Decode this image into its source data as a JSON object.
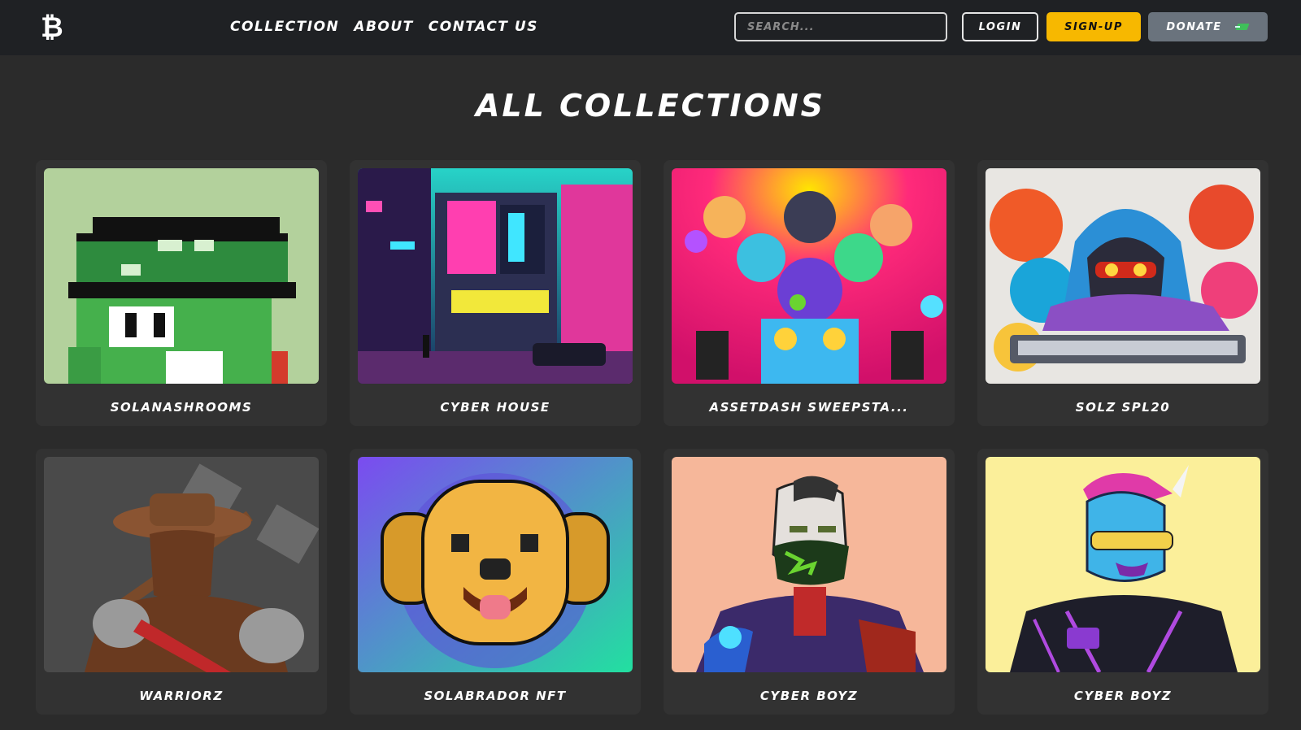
{
  "header": {
    "logo_glyph": "₿",
    "nav": [
      "Collection",
      "About",
      "Contact Us"
    ],
    "search_placeholder": "Search...",
    "login_label": "Login",
    "signup_label": "Sign-Up",
    "donate_label": "Donate"
  },
  "page": {
    "title": "All Collections"
  },
  "collections": [
    {
      "name": "SolanaShrooms"
    },
    {
      "name": "Cyber House"
    },
    {
      "name": "AssetDash Sweepsta..."
    },
    {
      "name": "solz SPL20"
    },
    {
      "name": "Warriorz"
    },
    {
      "name": "Solabrador NFT"
    },
    {
      "name": "Cyber Boyz"
    },
    {
      "name": "Cyber Boyz"
    }
  ],
  "colors": {
    "background": "#2b2b2b",
    "topbar": "#1f2124",
    "card": "#323232",
    "signup": "#f7b800",
    "donate": "#6a737d"
  }
}
